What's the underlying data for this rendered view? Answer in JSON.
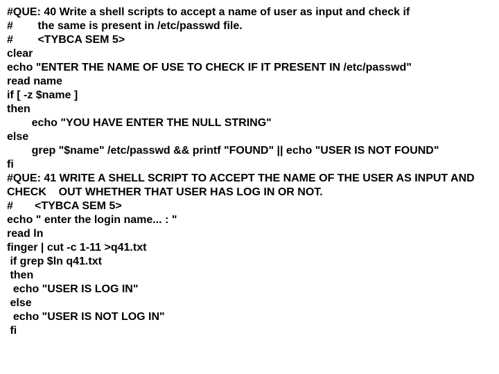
{
  "code": "#QUE: 40 Write a shell scripts to accept a name of user as input and check if\n#        the same is present in /etc/passwd file.\n#        <TYBCA SEM 5>\nclear\necho \"ENTER THE NAME OF USE TO CHECK IF IT PRESENT IN /etc/passwd\"\nread name\nif [ -z $name ]\nthen\n        echo \"YOU HAVE ENTER THE NULL STRING\"\nelse\n        grep \"$name\" /etc/passwd && printf \"FOUND\" || echo \"USER IS NOT FOUND\"\nfi\n#QUE: 41 WRITE A SHELL SCRIPT TO ACCEPT THE NAME OF THE USER AS INPUT AND CHECK    OUT WHETHER THAT USER HAS LOG IN OR NOT.\n#       <TYBCA SEM 5>\necho \" enter the login name... : \"\nread ln\nfinger | cut -c 1-11 >q41.txt\n if grep $ln q41.txt\n then\n  echo \"USER IS LOG IN\"\n else\n  echo \"USER IS NOT LOG IN\"\n fi"
}
